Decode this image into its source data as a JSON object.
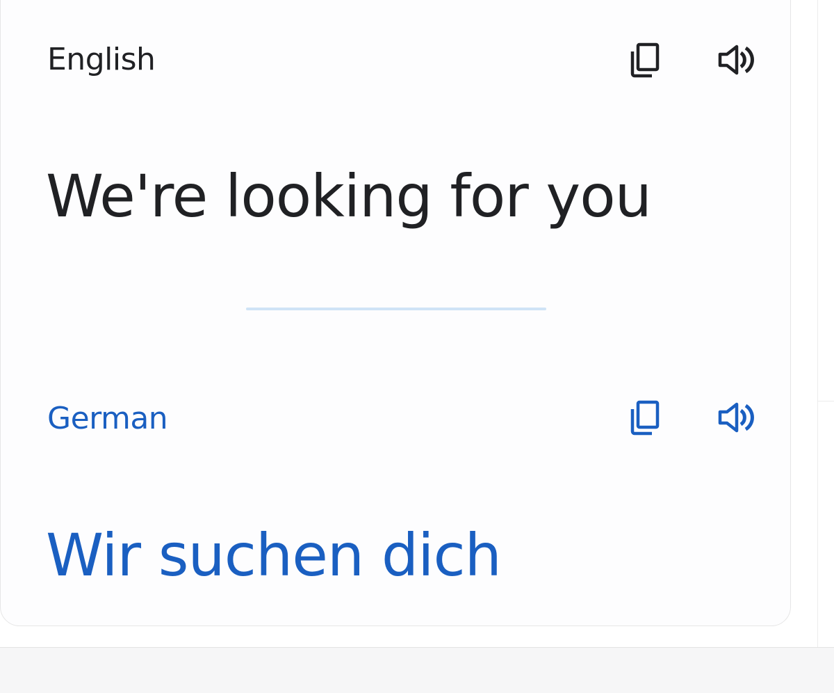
{
  "source": {
    "language": "English",
    "text": "We're looking for you",
    "icon_color": "#202124"
  },
  "target": {
    "language": "German",
    "text": "Wir suchen dich",
    "icon_color": "#1a5fc1"
  },
  "icons": {
    "copy": "copy-icon",
    "speak": "speaker-icon"
  },
  "colors": {
    "accent": "#1a5fc1",
    "text": "#202124",
    "divider": "#cfe3f6"
  }
}
